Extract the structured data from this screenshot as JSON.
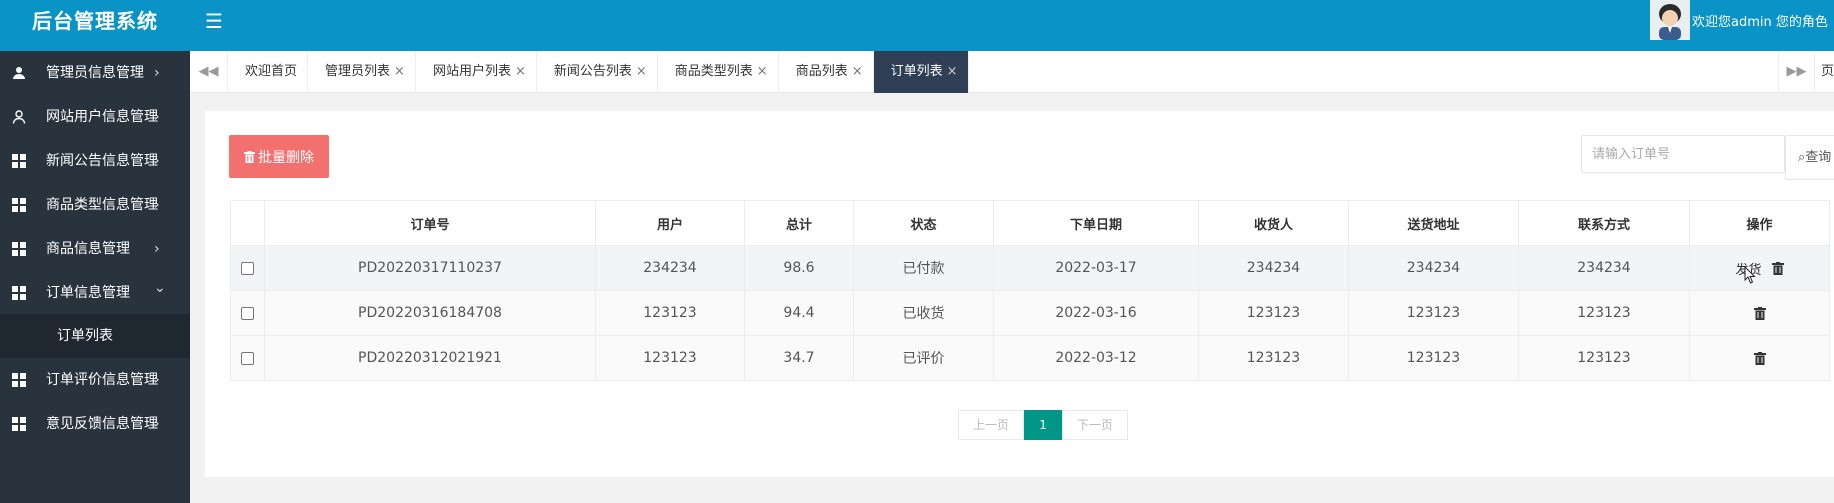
{
  "app": {
    "title": "后台管理系统"
  },
  "header": {
    "welcome_text": "欢迎您admin 您的角色"
  },
  "sidebar": {
    "items": [
      {
        "label": "管理员信息管理",
        "icon": "users-icon"
      },
      {
        "label": "网站用户信息管理",
        "icon": "user-icon"
      },
      {
        "label": "新闻公告信息管理",
        "icon": "grid-icon"
      },
      {
        "label": "商品类型信息管理",
        "icon": "grid-icon"
      },
      {
        "label": "商品信息管理",
        "icon": "grid-icon"
      },
      {
        "label": "订单信息管理",
        "icon": "grid-icon",
        "expanded": true
      },
      {
        "label": "订单评价信息管理",
        "icon": "grid-icon"
      },
      {
        "label": "意见反馈信息管理",
        "icon": "grid-icon"
      }
    ],
    "arrow_right": "›",
    "arrow_down": "⌄",
    "submenu": [
      {
        "label": "订单列表"
      }
    ]
  },
  "tabs": {
    "items": [
      {
        "label": "欢迎首页",
        "closable": false
      },
      {
        "label": "管理员列表",
        "closable": true
      },
      {
        "label": "网站用户列表",
        "closable": true
      },
      {
        "label": "新闻公告列表",
        "closable": true
      },
      {
        "label": "商品类型列表",
        "closable": true
      },
      {
        "label": "商品列表",
        "closable": true
      },
      {
        "label": "订单列表",
        "closable": true,
        "active": true
      }
    ],
    "close_glyph": "×",
    "nav_left": "◀◀",
    "nav_right": "▶▶",
    "extra_label": "页"
  },
  "toolbar": {
    "batch_delete_label": "批量删除",
    "search_placeholder": "请输入订单号",
    "search_label": "查询"
  },
  "table": {
    "columns": [
      "订单号",
      "用户",
      "总计",
      "状态",
      "下单日期",
      "收货人",
      "送货地址",
      "联系方式",
      "操作"
    ],
    "rows": [
      {
        "order_no": "PD20220317110237",
        "user": "234234",
        "total": "98.6",
        "status": "已付款",
        "date": "2022-03-17",
        "receiver": "234234",
        "address": "234234",
        "phone": "234234",
        "actions": [
          "发货",
          "delete"
        ]
      },
      {
        "order_no": "PD20220316184708",
        "user": "123123",
        "total": "94.4",
        "status": "已收货",
        "date": "2022-03-16",
        "receiver": "123123",
        "address": "123123",
        "phone": "123123",
        "actions": [
          "delete"
        ]
      },
      {
        "order_no": "PD20220312021921",
        "user": "123123",
        "total": "34.7",
        "status": "已评价",
        "date": "2022-03-12",
        "receiver": "123123",
        "address": "123123",
        "phone": "123123",
        "actions": [
          "delete"
        ]
      }
    ],
    "ship_label": "发货"
  },
  "pagination": {
    "prev_label": "上一页",
    "current_page": "1",
    "next_label": "下一页"
  },
  "colors": {
    "topbar": "#0a93c6",
    "sidebar": "#28333e",
    "active_tab": "#2f4056",
    "danger_button": "#f2706d",
    "pager_current": "#009688"
  }
}
